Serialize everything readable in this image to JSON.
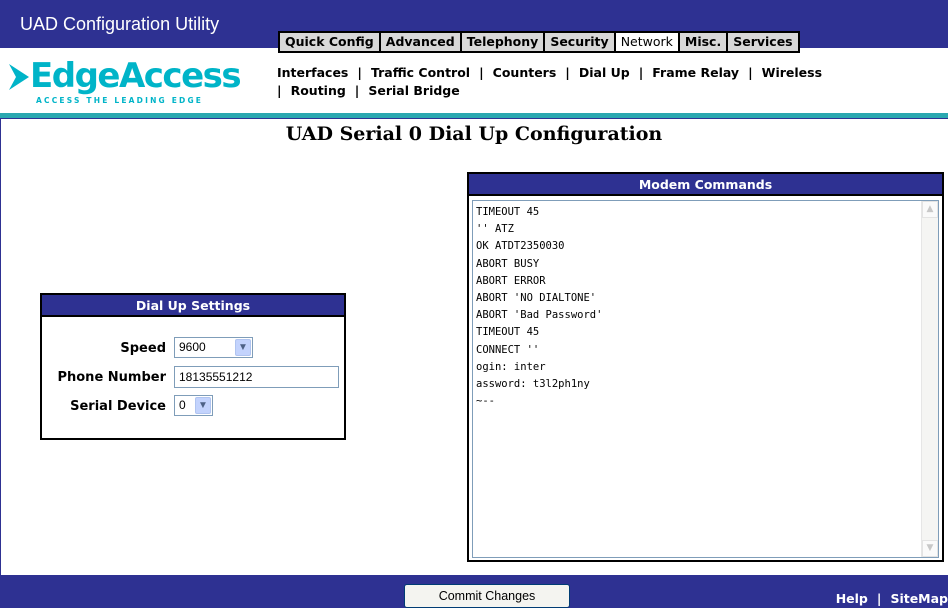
{
  "app": {
    "title": "UAD Configuration Utility"
  },
  "main_tabs": [
    {
      "label": "Quick Config",
      "active": false
    },
    {
      "label": "Advanced",
      "active": false
    },
    {
      "label": "Telephony",
      "active": false
    },
    {
      "label": "Security",
      "active": false
    },
    {
      "label": "Network",
      "active": true
    },
    {
      "label": "Misc.",
      "active": false
    },
    {
      "label": "Services",
      "active": false
    }
  ],
  "logo": {
    "text": "EdgeAccess",
    "tagline": "ACCESS THE LEADING EDGE"
  },
  "sub_nav": {
    "row1": [
      "Interfaces",
      "Traffic Control",
      "Counters",
      "Dial Up",
      "Frame Relay",
      "Wireless"
    ],
    "row2": [
      "Routing",
      "Serial Bridge"
    ],
    "separator": "|"
  },
  "page": {
    "title": "UAD Serial 0 Dial Up Configuration"
  },
  "dialup": {
    "header": "Dial Up Settings",
    "speed": {
      "label": "Speed",
      "value": "9600"
    },
    "phone": {
      "label": "Phone Number",
      "value": "18135551212"
    },
    "serial_device": {
      "label": "Serial Device",
      "value": "0"
    }
  },
  "modem": {
    "header": "Modem Commands",
    "text": "TIMEOUT 45\n'' ATZ\nOK ATDT2350030\nABORT BUSY\nABORT ERROR\nABORT 'NO DIALTONE'\nABORT 'Bad Password'\nTIMEOUT 45\nCONNECT ''\nogin: inter\nassword: t3l2ph1ny\n~--"
  },
  "footer": {
    "commit_label": "Commit Changes",
    "help_label": "Help",
    "sitemap_label": "SiteMap",
    "separator": "|"
  },
  "colors": {
    "brand_navy": "#2e3192",
    "accent_teal": "#2aa8b0",
    "logo_cyan": "#00b4c8"
  }
}
